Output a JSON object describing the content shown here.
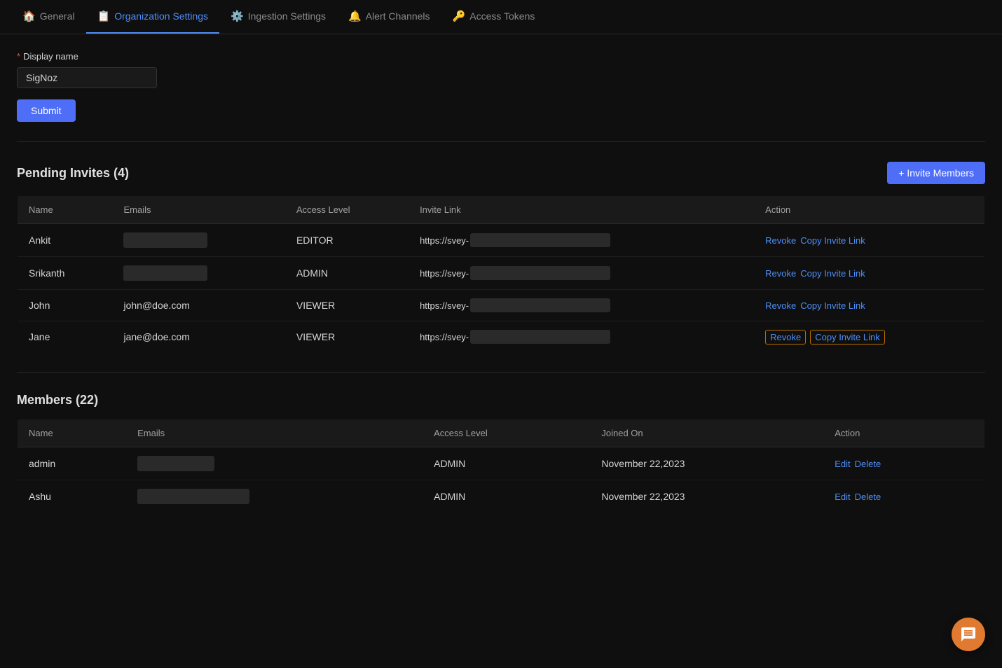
{
  "nav": {
    "tabs": [
      {
        "id": "general",
        "label": "General",
        "icon": "🏠",
        "active": false
      },
      {
        "id": "org-settings",
        "label": "Organization Settings",
        "icon": "📋",
        "active": true
      },
      {
        "id": "ingestion",
        "label": "Ingestion Settings",
        "icon": "⚙️",
        "active": false
      },
      {
        "id": "alert-channels",
        "label": "Alert Channels",
        "icon": "🔔",
        "active": false
      },
      {
        "id": "access-tokens",
        "label": "Access Tokens",
        "icon": "🔑",
        "active": false
      }
    ]
  },
  "display_name_section": {
    "label": "Display name",
    "required_marker": "*",
    "value": "SigNoz",
    "submit_label": "Submit"
  },
  "pending_invites": {
    "title": "Pending Invites",
    "count": "(4)",
    "invite_button_label": "+ Invite Members",
    "columns": [
      "Name",
      "Emails",
      "Access Level",
      "Invite Link",
      "Action"
    ],
    "rows": [
      {
        "name": "Ankit",
        "email_redacted": true,
        "email_width": 120,
        "access_level": "EDITOR",
        "invite_link_prefix": "https://svey-",
        "invite_link_redacted_width": 200,
        "actions": [
          "Revoke",
          "Copy Invite Link"
        ],
        "highlighted": false
      },
      {
        "name": "Srikanth",
        "email_redacted": true,
        "email_width": 120,
        "access_level": "ADMIN",
        "invite_link_prefix": "https://svey-",
        "invite_link_redacted_width": 200,
        "actions": [
          "Revoke",
          "Copy Invite Link"
        ],
        "highlighted": false
      },
      {
        "name": "John",
        "email_redacted": false,
        "email": "john@doe.com",
        "access_level": "VIEWER",
        "invite_link_prefix": "https://svey-",
        "invite_link_redacted_width": 200,
        "actions": [
          "Revoke",
          "Copy Invite Link"
        ],
        "highlighted": false
      },
      {
        "name": "Jane",
        "email_redacted": false,
        "email": "jane@doe.com",
        "access_level": "VIEWER",
        "invite_link_prefix": "https://svey-",
        "invite_link_redacted_width": 200,
        "actions": [
          "Revoke",
          "Copy Invite Link"
        ],
        "highlighted": true
      }
    ]
  },
  "members": {
    "title": "Members",
    "count": "(22)",
    "columns": [
      "Name",
      "Emails",
      "Access Level",
      "Joined On",
      "Action"
    ],
    "rows": [
      {
        "name": "admin",
        "email_redacted": true,
        "email_width": 110,
        "access_level": "ADMIN",
        "joined_on": "November 22,2023",
        "actions": [
          "Edit",
          "Delete"
        ]
      },
      {
        "name": "Ashu",
        "email_redacted": true,
        "email_width": 160,
        "access_level": "ADMIN",
        "joined_on": "November 22,2023",
        "actions": [
          "Edit",
          "Delete"
        ]
      }
    ]
  },
  "labels": {
    "revoke": "Revoke",
    "copy_invite_link": "Copy Invite Link",
    "edit": "Edit",
    "delete": "Delete"
  }
}
